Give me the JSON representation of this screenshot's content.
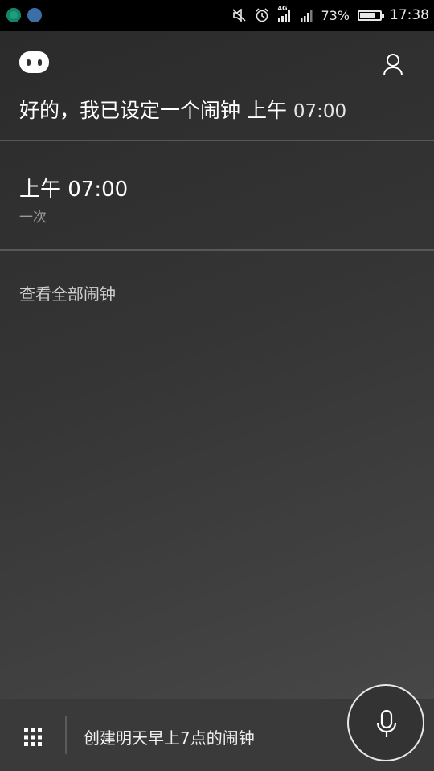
{
  "status_bar": {
    "battery_percent_label": "73%",
    "battery_level": 0.73,
    "network_label": "4G",
    "time": "17:38",
    "icons": [
      "app-notification-icon",
      "screenshot-notification-icon",
      "mute-icon",
      "alarm-icon",
      "mobile-data-icon",
      "signal-icon",
      "battery-icon"
    ]
  },
  "header": {
    "logo_icon": "assistant-logo-icon",
    "profile_icon": "profile-icon",
    "response_prefix": "好的，我已设定一个闹钟 上午",
    "response_time": "07:00"
  },
  "alarm": {
    "time_label": "上午 07:00",
    "repeat_label": "一次"
  },
  "actions": {
    "view_all_label": "查看全部闹钟"
  },
  "bottom_bar": {
    "keyboard_icon": "keyboard-grid-icon",
    "query_text": "创建明天早上7点的闹钟",
    "mic_icon": "microphone-icon"
  },
  "colors": {
    "background": "#353535",
    "status_bar": "#000000",
    "text_primary": "#ffffff",
    "text_secondary": "#9a9a9a"
  }
}
